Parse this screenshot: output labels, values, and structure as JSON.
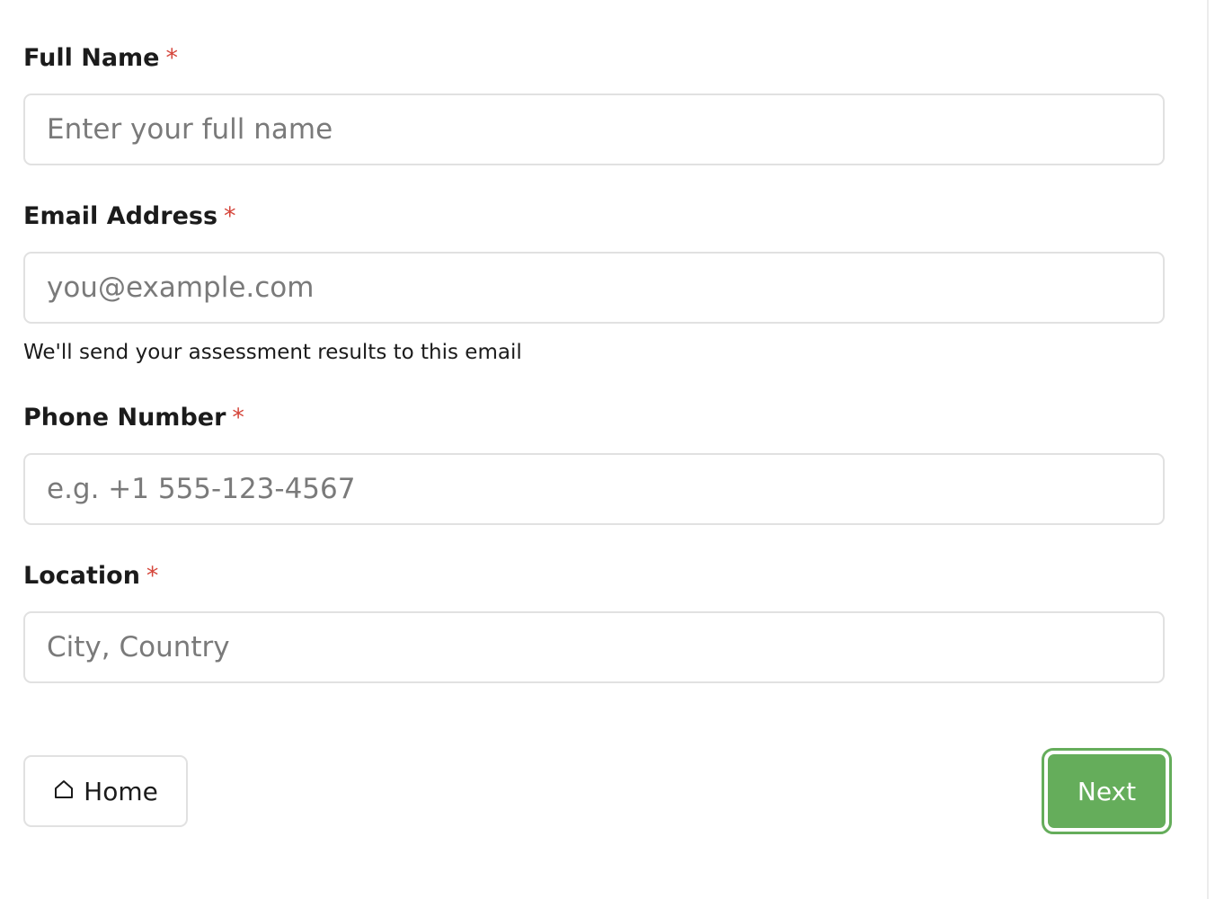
{
  "form": {
    "full_name": {
      "label": "Full Name",
      "required_mark": "*",
      "placeholder": "Enter your full name",
      "value": ""
    },
    "email": {
      "label": "Email Address",
      "required_mark": "*",
      "placeholder": "you@example.com",
      "value": "",
      "hint": "We'll send your assessment results to this email"
    },
    "phone": {
      "label": "Phone Number",
      "required_mark": "*",
      "placeholder": "e.g. +1 555-123-4567",
      "value": ""
    },
    "location": {
      "label": "Location",
      "required_mark": "*",
      "placeholder": "City, Country",
      "value": ""
    }
  },
  "actions": {
    "home_label": "Home",
    "home_icon": "home-icon",
    "next_label": "Next"
  },
  "colors": {
    "accent": "#65ad5b",
    "required": "#d5463b",
    "border": "#e1e1e1",
    "placeholder": "#7a7a7a"
  }
}
